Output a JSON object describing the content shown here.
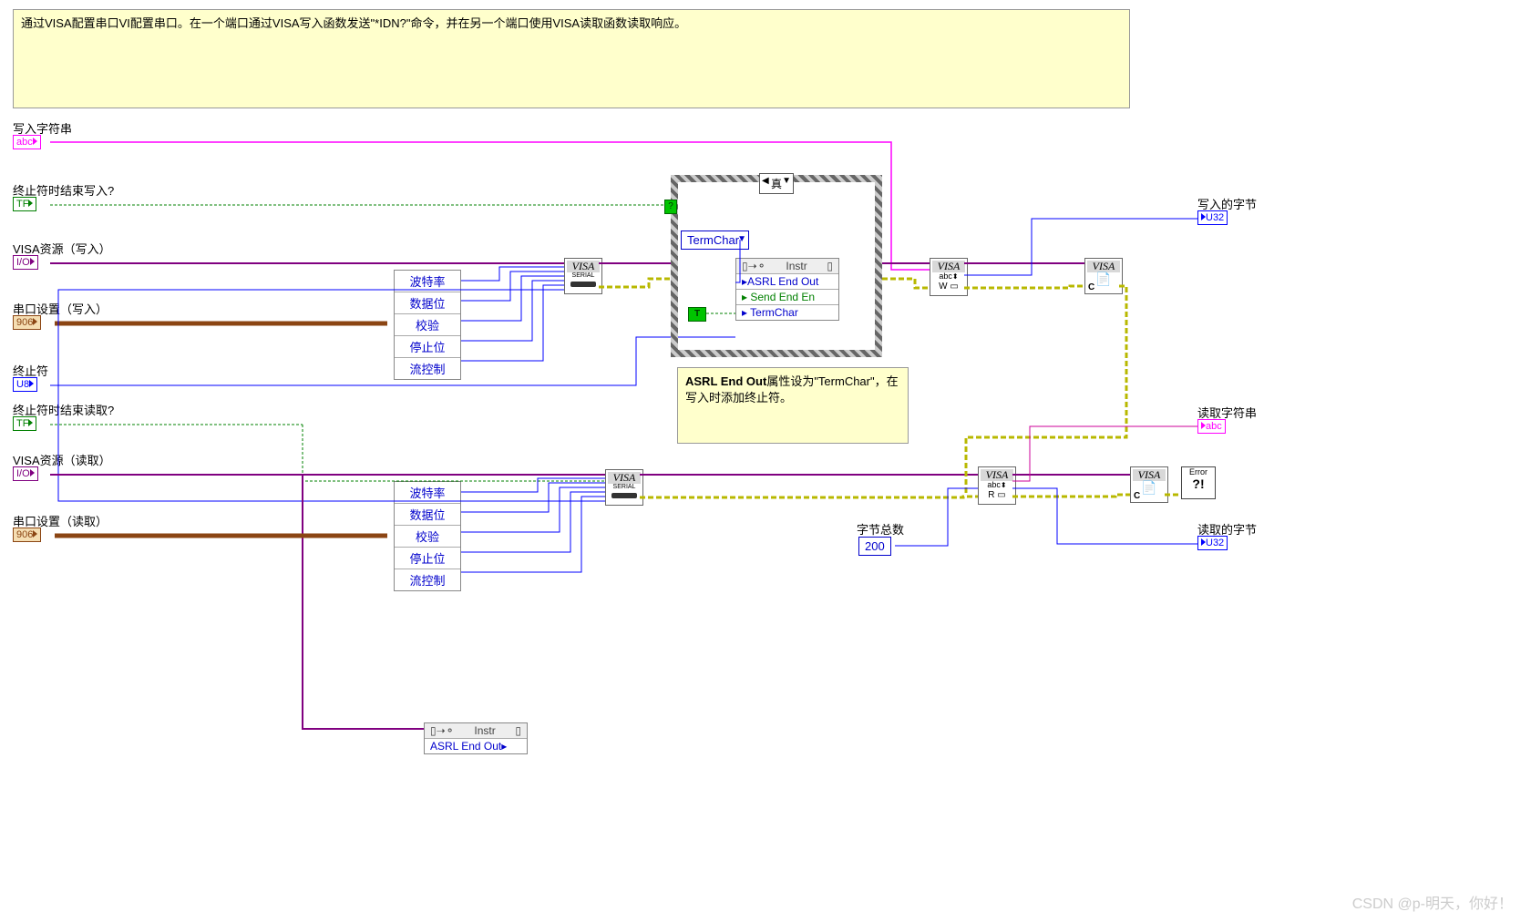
{
  "description": "通过VISA配置串口VI配置串口。在一个端口通过VISA写入函数发送\"*IDN?\"命令，并在另一个端口使用VISA读取函数读取响应。",
  "terminals": {
    "write_string": {
      "label": "写入字符串",
      "type": "abc"
    },
    "end_write": {
      "label": "终止符时结束写入?",
      "type": "TF"
    },
    "visa_write": {
      "label": "VISA资源（写入）",
      "type": "I/O"
    },
    "port_write": {
      "label": "串口设置（写入）",
      "type": "906"
    },
    "term_char": {
      "label": "终止符",
      "type": "U8"
    },
    "end_read": {
      "label": "终止符时结束读取?",
      "type": "TF"
    },
    "visa_read": {
      "label": "VISA资源（读取）",
      "type": "I/O"
    },
    "port_read": {
      "label": "串口设置（读取）",
      "type": "906"
    }
  },
  "unbundle_items": [
    "波特率",
    "数据位",
    "校验",
    "停止位",
    "流控制"
  ],
  "nodes": {
    "visa_serial": {
      "hdr": "VISA",
      "sub": "SERIAL"
    },
    "visa_write_node": {
      "hdr": "VISA",
      "sub": "abc",
      "suffix": "W",
      "icon": "□"
    },
    "visa_close1": {
      "hdr": "VISA",
      "icon": "C"
    },
    "visa_read_node": {
      "hdr": "VISA",
      "sub": "abc",
      "suffix": "R",
      "icon": "□"
    },
    "visa_close2": {
      "hdr": "VISA",
      "icon": "C"
    }
  },
  "case": {
    "selector": "真"
  },
  "termchar_ring": "TermChar",
  "prop_node1": {
    "hdr": "Instr",
    "items": [
      "ASRL End Out",
      "Send End En",
      "TermChar"
    ]
  },
  "prop_node2": {
    "hdr": "Instr",
    "items": [
      "ASRL End Out"
    ]
  },
  "note": {
    "title": "ASRL End Out",
    "body": "属性设为\"TermChar\"，在写入时添加终止符。"
  },
  "byte_total": {
    "label": "字节总数",
    "value": "200"
  },
  "indicators": {
    "bytes_written": {
      "label": "写入的字节",
      "type": "U32"
    },
    "read_string": {
      "label": "读取字符串",
      "type": "abc"
    },
    "bytes_read": {
      "label": "读取的字节",
      "type": "U32"
    }
  },
  "error": "Error",
  "watermark": "CSDN @p-明天，你好！",
  "bool_const": "T"
}
